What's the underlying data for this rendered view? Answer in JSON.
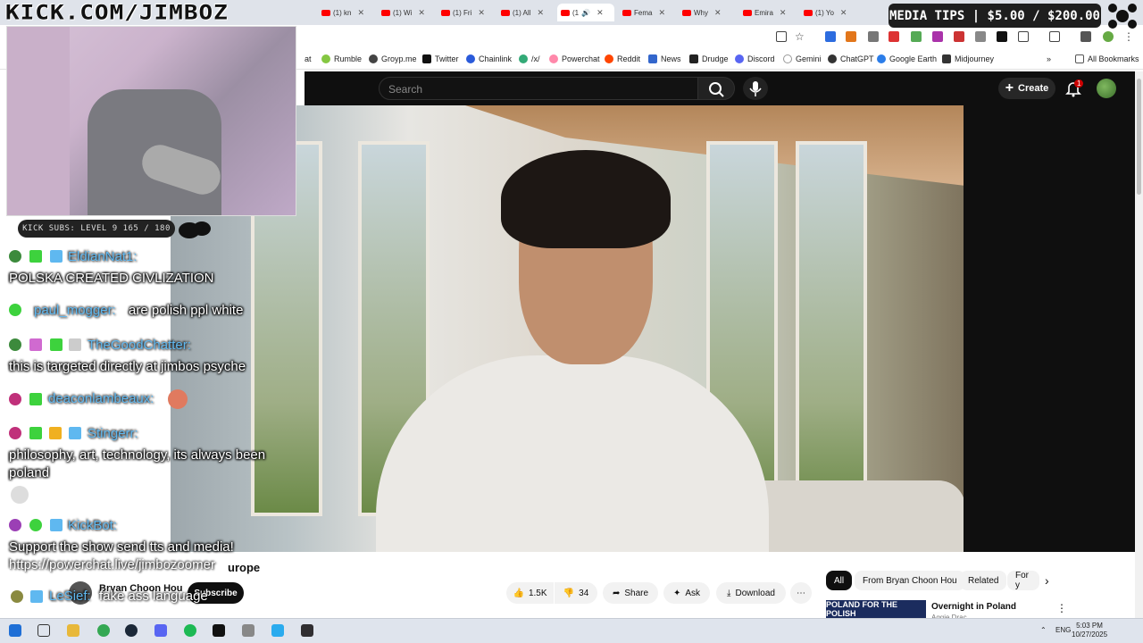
{
  "overlay": {
    "title": "KICK.COM/JIMBOZ",
    "kick_subs": "KICK SUBS: LEVEL 9 165 / 180",
    "media_tips": "MEDIA TIPS | $5.00 / $200.00",
    "powerchat_url": "https://powerchat.live/jimbozoomer"
  },
  "tabs": [
    {
      "label": "(1) kn"
    },
    {
      "label": "(1) Wi"
    },
    {
      "label": "(1) Fri"
    },
    {
      "label": "(1) All"
    },
    {
      "label": "(1"
    },
    {
      "label": "Fema"
    },
    {
      "label": "Why"
    },
    {
      "label": "Emira"
    },
    {
      "label": "(1) Yo"
    }
  ],
  "bookmarks": [
    "at",
    "Rumble",
    "Groyp.me",
    "Twitter",
    "Chainlink",
    "/x/",
    "Powerchat",
    "Reddit",
    "News",
    "Drudge",
    "Discord",
    "Gemini",
    "ChatGPT",
    "Google Earth",
    "Midjourney",
    "All Bookmarks"
  ],
  "youtube": {
    "search_placeholder": "Search",
    "create_label": "Create",
    "notif_count": "1",
    "video_title_fragment": "urope",
    "channel_name": "Bryan Choon Hou",
    "subscribe_label": "Subscribe",
    "likes": "1.5K",
    "dislikes": "34",
    "share_label": "Share",
    "ask_label": "Ask",
    "download_label": "Download",
    "filters": [
      "All",
      "From Bryan Choon Hou",
      "Related",
      "For y"
    ],
    "rec_thumb_text": "POLAND FOR THE POLISH",
    "rec_title": "Overnight in Poland",
    "rec_channel": "Aggie Drac"
  },
  "chat": [
    {
      "user": "EldianNat1:",
      "user_color": "#5fb8f0",
      "message": "POLSKA CREATED CIVLIZATION"
    },
    {
      "user": "paul_mogger:",
      "user_color": "#5fb8f0",
      "message": "are polish ppl white"
    },
    {
      "user": "TheGoodChatter:",
      "user_color": "#5fb8f0",
      "message": "this is targeted directly at jimbos psyche"
    },
    {
      "user": "deaconlambeaux:",
      "user_color": "#5fb8f0",
      "message": ""
    },
    {
      "user": "Stingerr:",
      "user_color": "#5fb8f0",
      "message_line1": "philosophy, art, technology, its always been",
      "message_line2": "poland"
    },
    {
      "user": "KickBot:",
      "user_color": "#5fb8f0",
      "message": "Support the show send tts and media!"
    },
    {
      "user": "LeSief:",
      "user_color": "#5fb8f0",
      "message": "fake ass language"
    }
  ],
  "taskbar": {
    "lang": "ENG",
    "time": "5:03 PM",
    "date": "10/27/2025"
  }
}
